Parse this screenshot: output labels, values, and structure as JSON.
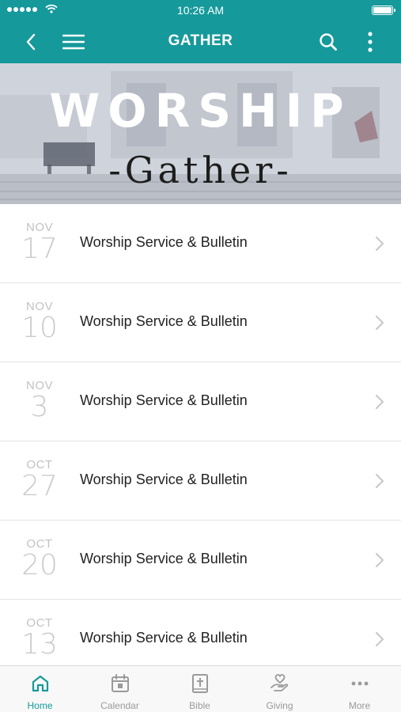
{
  "status_bar": {
    "time": "10:26 AM",
    "signal_icon": "signal-dots-icon",
    "wifi_icon": "wifi-icon",
    "battery_icon": "battery-icon"
  },
  "nav": {
    "title": "GATHER",
    "back_icon": "chevron-left-icon",
    "menu_icon": "hamburger-menu-icon",
    "search_icon": "search-icon",
    "more_icon": "vertical-ellipsis-icon"
  },
  "banner": {
    "heading": "WORSHIP",
    "subheading": "-Gather-"
  },
  "events": [
    {
      "month": "NOV",
      "day": "17",
      "title": "Worship Service & Bulletin"
    },
    {
      "month": "NOV",
      "day": "10",
      "title": "Worship Service & Bulletin"
    },
    {
      "month": "NOV",
      "day": "3",
      "title": "Worship Service & Bulletin"
    },
    {
      "month": "OCT",
      "day": "27",
      "title": "Worship Service & Bulletin"
    },
    {
      "month": "OCT",
      "day": "20",
      "title": "Worship Service & Bulletin"
    },
    {
      "month": "OCT",
      "day": "13",
      "title": "Worship Service & Bulletin"
    }
  ],
  "tabs": [
    {
      "label": "Home",
      "icon": "home-icon",
      "active": true
    },
    {
      "label": "Calendar",
      "icon": "calendar-icon",
      "active": false
    },
    {
      "label": "Bible",
      "icon": "bible-icon",
      "active": false
    },
    {
      "label": "Giving",
      "icon": "giving-hand-heart-icon",
      "active": false
    },
    {
      "label": "More",
      "icon": "more-dots-icon",
      "active": false
    }
  ],
  "colors": {
    "accent": "#16999b",
    "inactive": "#9a9a9a",
    "date_text": "#c2c2c2"
  }
}
